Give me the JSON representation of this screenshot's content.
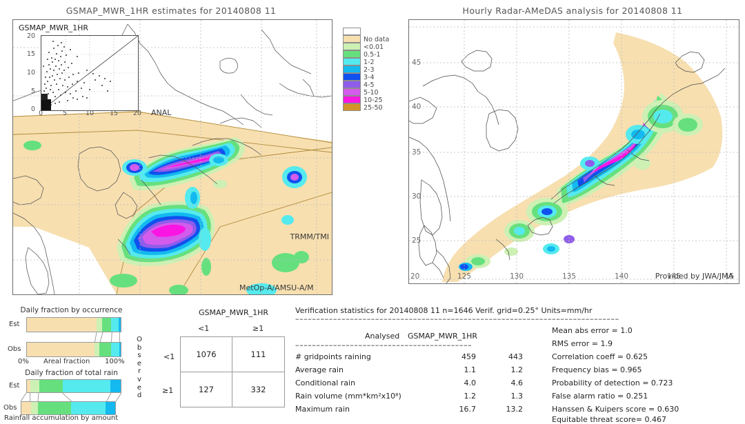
{
  "left_panel": {
    "title": "GSMAP_MWR_1HR estimates for 20140808 11",
    "inset": {
      "title": "GSMAP_MWR_1HR",
      "y_ticks": [
        "20",
        "15",
        "10",
        "5",
        "0"
      ],
      "x_ticks": [
        "0",
        "5",
        "10",
        "15",
        "20"
      ],
      "x_axis_label": "ANAL"
    },
    "tags": {
      "trmm": "TRMM/TMI",
      "metop": "MetOp-A/AMSU-A/M"
    }
  },
  "right_panel": {
    "title": "Hourly Radar-AMeDAS analysis for 20140808 11",
    "lat_ticks": [
      "45",
      "40",
      "35",
      "30",
      "25",
      "20"
    ],
    "lon_ticks": [
      "125",
      "130",
      "135",
      "140",
      "145",
      "15"
    ],
    "credit": "Provided by JWA/JMA"
  },
  "colorbar": {
    "name": "rainfall-rate-legend",
    "units": "mm/hr",
    "entries": [
      {
        "label": "",
        "color": "#ffffff"
      },
      {
        "label": "No data",
        "color": "#f7dfb0"
      },
      {
        "label": "<0.01",
        "color": "#cdf0b4"
      },
      {
        "label": "0.5-1",
        "color": "#66e07e"
      },
      {
        "label": "1-2",
        "color": "#55eaee"
      },
      {
        "label": "2-3",
        "color": "#13b9ef"
      },
      {
        "label": "3-4",
        "color": "#1050ee"
      },
      {
        "label": "4-5",
        "color": "#8f5ceb"
      },
      {
        "label": "5-10",
        "color": "#d35cec"
      },
      {
        "label": "10-25",
        "color": "#fa15e3"
      },
      {
        "label": "25-50",
        "color": "#d49327"
      }
    ]
  },
  "occurrence_chart": {
    "title": "Daily fraction by occurrence",
    "axis_label": "Areal fraction",
    "scale_min": "0%",
    "scale_max": "100%",
    "rows": [
      {
        "label": "Est",
        "segments": [
          {
            "color": "#f7dfb0",
            "pct": 74.0
          },
          {
            "color": "#cdf0b4",
            "pct": 6.5
          },
          {
            "color": "#66e07e",
            "pct": 9.5
          },
          {
            "color": "#55eaee",
            "pct": 8.0
          },
          {
            "color": "#13b9ef",
            "pct": 2.0
          }
        ]
      },
      {
        "label": "Obs",
        "segments": [
          {
            "color": "#f7dfb0",
            "pct": 72.0
          },
          {
            "color": "#cdf0b4",
            "pct": 5.5
          },
          {
            "color": "#66e07e",
            "pct": 12.0
          },
          {
            "color": "#55eaee",
            "pct": 9.0
          },
          {
            "color": "#13b9ef",
            "pct": 1.5
          }
        ]
      }
    ]
  },
  "amount_chart": {
    "title": "Daily fraction of total rain",
    "axis_label": "Rainfall accumulation by amount",
    "rows": [
      {
        "label": "Est",
        "segments": [
          {
            "color": "#f7dfb0",
            "pct": 4.0
          },
          {
            "color": "#cdf0b4",
            "pct": 9.0
          },
          {
            "color": "#66e07e",
            "pct": 25.0
          },
          {
            "color": "#55eaee",
            "pct": 51.0
          },
          {
            "color": "#13b9ef",
            "pct": 11.0
          }
        ]
      },
      {
        "label": "Obs",
        "segments": [
          {
            "color": "#f7dfb0",
            "pct": 10.0
          },
          {
            "color": "#cdf0b4",
            "pct": 8.0
          },
          {
            "color": "#66e07e",
            "pct": 35.0
          },
          {
            "color": "#55eaee",
            "pct": 37.0
          },
          {
            "color": "#13b9ef",
            "pct": 10.0
          }
        ]
      }
    ]
  },
  "contingency": {
    "title": "GSMAP_MWR_1HR",
    "col_headers": [
      "<1",
      "≥1"
    ],
    "row_headers": [
      "<1",
      "≥1"
    ],
    "observed_label": "Observed",
    "cells": [
      [
        "1076",
        "111"
      ],
      [
        "127",
        "332"
      ]
    ]
  },
  "verification": {
    "header": "Verification statistics for 20140808 11  n=1646  Verif. grid=0.25°  Units=mm/hr",
    "divider": "- - - - - - - - - - - - - - - - - - - - - - - - - - - - - - - - - - - - - - - - - - - - - - - - - - - - - - -",
    "col_headers": [
      "Analysed",
      "GSMAP_MWR_1HR"
    ],
    "sub_divider": "- - - - - - - - - - - - - - - - - - - - - - - - - -",
    "rows": [
      {
        "name": "# gridpoints raining",
        "analysed": "459",
        "estimate": "443"
      },
      {
        "name": "Average rain",
        "analysed": "1.1",
        "estimate": "1.2"
      },
      {
        "name": "Conditional rain",
        "analysed": "4.0",
        "estimate": "4.6"
      },
      {
        "name": "Rain volume (mm*km²x10⁸)",
        "analysed": "1.2",
        "estimate": "1.3"
      },
      {
        "name": "Maximum rain",
        "analysed": "16.7",
        "estimate": "13.2"
      }
    ],
    "scores": [
      "Mean abs error = 1.0",
      "RMS error = 1.9",
      "Correlation coeff = 0.625",
      "Frequency bias = 0.965",
      "Probability of detection = 0.723",
      "False alarm ratio = 0.251",
      "Hanssen & Kuipers score = 0.630",
      "Equitable threat score= 0.467"
    ]
  },
  "chart_data": [
    {
      "type": "bar",
      "title": "Daily fraction by occurrence",
      "xlabel": "Areal fraction",
      "ylabel": "",
      "orientation": "horizontal-stacked",
      "xlim": [
        0,
        100
      ],
      "categories": [
        "Est",
        "Obs"
      ],
      "series": [
        {
          "name": "No data / <0.01 baseline",
          "color": "#f7dfb0",
          "values": [
            74.0,
            72.0
          ]
        },
        {
          "name": "<0.01",
          "color": "#cdf0b4",
          "values": [
            6.5,
            5.5
          ]
        },
        {
          "name": "0.5-1",
          "color": "#66e07e",
          "values": [
            9.5,
            12.0
          ]
        },
        {
          "name": "1-2",
          "color": "#55eaee",
          "values": [
            8.0,
            9.0
          ]
        },
        {
          "name": "2-3",
          "color": "#13b9ef",
          "values": [
            2.0,
            1.5
          ]
        }
      ]
    },
    {
      "type": "bar",
      "title": "Daily fraction of total rain",
      "xlabel": "Rainfall accumulation by amount",
      "ylabel": "",
      "orientation": "horizontal-stacked",
      "xlim": [
        0,
        100
      ],
      "categories": [
        "Est",
        "Obs"
      ],
      "series": [
        {
          "name": "<0.01 baseline",
          "color": "#f7dfb0",
          "values": [
            4.0,
            10.0
          ]
        },
        {
          "name": "<0.01",
          "color": "#cdf0b4",
          "values": [
            9.0,
            8.0
          ]
        },
        {
          "name": "0.5-1",
          "color": "#66e07e",
          "values": [
            25.0,
            35.0
          ]
        },
        {
          "name": "1-2",
          "color": "#55eaee",
          "values": [
            51.0,
            37.0
          ]
        },
        {
          "name": "2-3",
          "color": "#13b9ef",
          "values": [
            11.0,
            10.0
          ]
        }
      ]
    },
    {
      "type": "scatter",
      "title": "GSMAP_MWR_1HR",
      "xlabel": "ANAL",
      "ylabel": "",
      "xlim": [
        0,
        20
      ],
      "ylim": [
        0,
        20
      ],
      "xticks": [
        0,
        5,
        10,
        15,
        20
      ],
      "yticks": [
        0,
        5,
        10,
        15,
        20
      ],
      "notes": "Dense cluster near origin, points skewed above 1:1 line; 1:1 reference line drawn."
    },
    {
      "type": "table",
      "title": "Contingency table GSMAP_MWR_1HR vs Observed",
      "columns": [
        "<1",
        "≥1"
      ],
      "rows": [
        "<1",
        "≥1"
      ],
      "values": [
        [
          1076,
          111
        ],
        [
          127,
          332
        ]
      ]
    },
    {
      "type": "heatmap",
      "title": "GSMAP_MWR_1HR estimates for 20140808 11",
      "notes": "Satellite rainfall-rate map over Japan/East Asia, colour scale 0.01-50 mm/hr",
      "xlim": [
        118,
        150
      ],
      "ylim": [
        18,
        50
      ]
    },
    {
      "type": "heatmap",
      "title": "Hourly Radar-AMeDAS analysis for 20140808 11",
      "notes": "Radar-AMeDAS analysed rainfall map over Japan, colour scale 0.01-50 mm/hr",
      "xlim": [
        120,
        150
      ],
      "ylim": [
        20,
        50
      ],
      "xticks": [
        125,
        130,
        135,
        140,
        145
      ],
      "yticks": [
        20,
        25,
        30,
        35,
        40,
        45
      ]
    }
  ]
}
